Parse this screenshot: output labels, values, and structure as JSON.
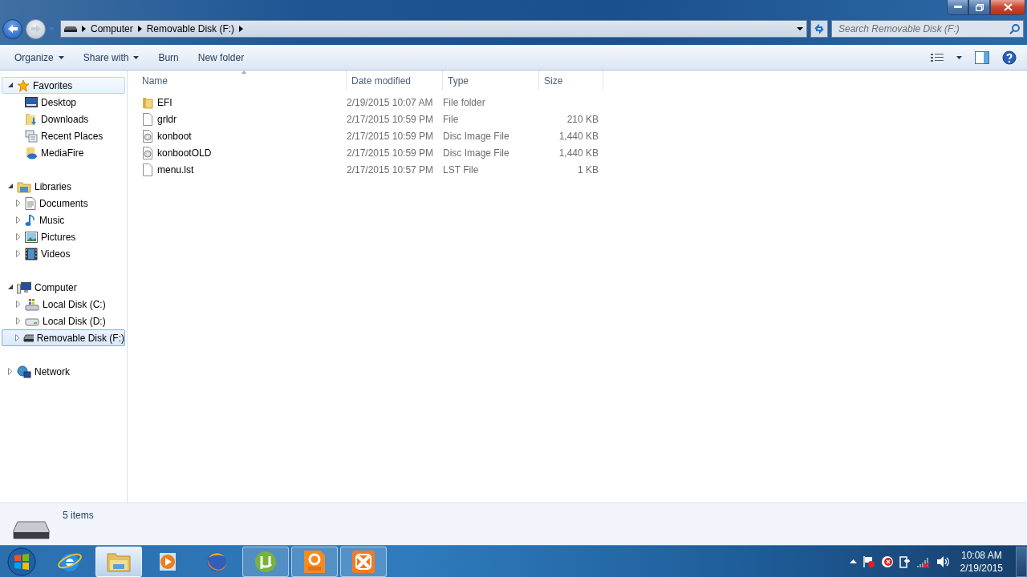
{
  "window": {
    "controls": [
      {
        "kind": "minimize"
      },
      {
        "kind": "restore"
      },
      {
        "kind": "close"
      }
    ]
  },
  "navigation": {
    "back_disabled": false,
    "forward_disabled": true
  },
  "address_bar": {
    "breadcrumbs": [
      "Computer",
      "Removable Disk (F:)"
    ],
    "search": {
      "placeholder": "Search Removable Disk (F:)"
    }
  },
  "toolbar": {
    "buttons": [
      {
        "label": "Organize",
        "dropdown": true
      },
      {
        "label": "Share with",
        "dropdown": true
      },
      {
        "label": "Burn",
        "dropdown": false
      },
      {
        "label": "New folder",
        "dropdown": false
      }
    ]
  },
  "sidebar": {
    "groups": [
      {
        "label": "Favorites",
        "kind": "star",
        "expanded": true,
        "selected": false,
        "hovered": true,
        "children": [
          {
            "label": "Desktop",
            "kind": "desktop",
            "selected": false
          },
          {
            "label": "Downloads",
            "kind": "downloads",
            "selected": false
          },
          {
            "label": "Recent Places",
            "kind": "recent",
            "selected": false
          },
          {
            "label": "MediaFire",
            "kind": "mediafire",
            "selected": false
          }
        ]
      },
      {
        "label": "Libraries",
        "kind": "library",
        "expanded": true,
        "selected": false,
        "hovered": false,
        "children": [
          {
            "label": "Documents",
            "kind": "documents",
            "expanded": false,
            "selected": false
          },
          {
            "label": "Music",
            "kind": "music",
            "expanded": false,
            "selected": false
          },
          {
            "label": "Pictures",
            "kind": "pictures",
            "expanded": false,
            "selected": false
          },
          {
            "label": "Videos",
            "kind": "videos",
            "expanded": false,
            "selected": false
          }
        ]
      },
      {
        "label": "Computer",
        "kind": "computer",
        "expanded": true,
        "selected": false,
        "hovered": false,
        "children": [
          {
            "label": "Local Disk (C:)",
            "kind": "system-disk",
            "expanded": false,
            "selected": false
          },
          {
            "label": "Local Disk (D:)",
            "kind": "disk",
            "expanded": false,
            "selected": false
          },
          {
            "label": "Removable Disk (F:)",
            "kind": "removable",
            "expanded": false,
            "selected": true
          }
        ]
      },
      {
        "label": "Network",
        "kind": "network",
        "expanded": false,
        "selected": false,
        "hovered": false
      }
    ]
  },
  "table": {
    "columns": [
      {
        "label": "Name",
        "sorted": true
      },
      {
        "label": "Date modified",
        "sorted": false
      },
      {
        "label": "Type",
        "sorted": false
      },
      {
        "label": "Size",
        "sorted": false
      }
    ],
    "rows": [
      {
        "kind": "folder",
        "cells": [
          "EFI",
          "2/19/2015 10:07 AM",
          "File folder",
          ""
        ]
      },
      {
        "kind": "file",
        "cells": [
          "grldr",
          "2/17/2015 10:59 PM",
          "File",
          "210 KB"
        ]
      },
      {
        "kind": "disc",
        "cells": [
          "konboot",
          "2/17/2015 10:59 PM",
          "Disc Image File",
          "1,440 KB"
        ]
      },
      {
        "kind": "disc",
        "cells": [
          "konbootOLD",
          "2/17/2015 10:59 PM",
          "Disc Image File",
          "1,440 KB"
        ]
      },
      {
        "kind": "file",
        "cells": [
          "menu.lst",
          "2/17/2015 10:57 PM",
          "LST File",
          "1 KB"
        ]
      }
    ]
  },
  "status_bar": {
    "count": "5 items"
  },
  "taskbar": {
    "apps": [
      {
        "kind": "globe",
        "open": false,
        "selected": false
      },
      {
        "kind": "folder",
        "open": true,
        "selected": true
      },
      {
        "kind": "media",
        "open": false,
        "selected": false
      },
      {
        "kind": "fox",
        "open": false,
        "selected": false
      },
      {
        "kind": "torrent",
        "open": true,
        "selected": false
      },
      {
        "kind": "pdf",
        "open": true,
        "selected": false
      },
      {
        "kind": "server",
        "open": true,
        "selected": false
      }
    ],
    "tray": [
      {
        "kind": "flag"
      },
      {
        "kind": "stop"
      },
      {
        "kind": "power"
      },
      {
        "kind": "signal"
      },
      {
        "kind": "speaker"
      }
    ],
    "time": "10:08 AM",
    "date": "2/19/2015"
  }
}
